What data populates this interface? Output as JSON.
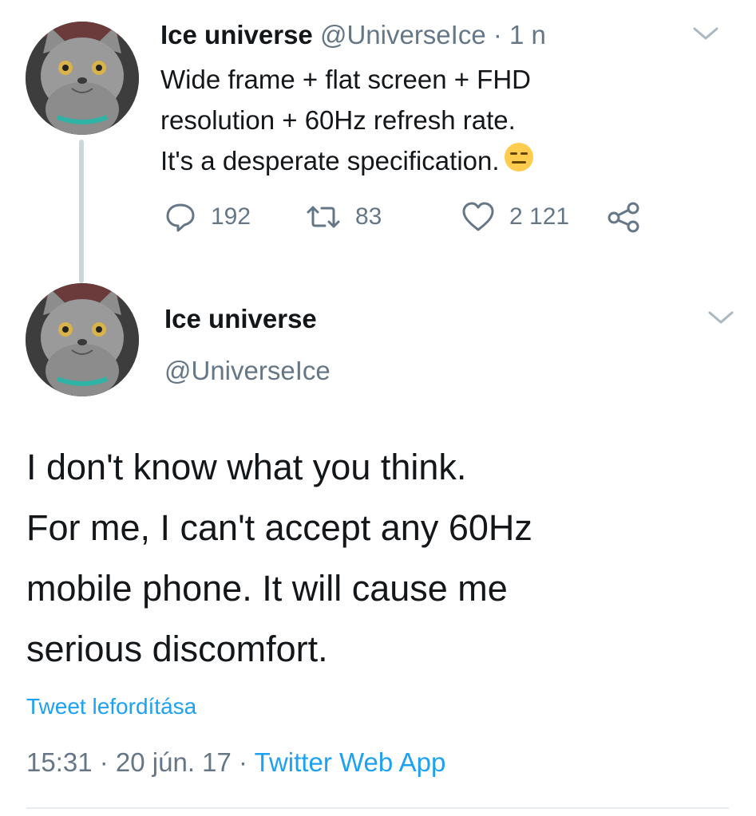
{
  "tweet1": {
    "name": "Ice universe",
    "handle": "@UniverseIce",
    "separator": " · ",
    "time": "1 n",
    "text_lines": [
      "Wide frame + flat screen + FHD",
      "resolution + 60Hz refresh rate.",
      "It's a desperate specification."
    ],
    "emoji": "expressionless-face",
    "replies": "192",
    "retweets": "83",
    "likes": "2 121"
  },
  "tweet2": {
    "name": "Ice universe",
    "handle": "@UniverseIce",
    "text_lines": [
      "I don't know what you think.",
      "For me, I can't accept any 60Hz",
      "mobile phone. It will cause me",
      "serious discomfort."
    ],
    "translate_label": "Tweet lefordítása",
    "time": "15:31",
    "date": "20 jún. 17",
    "separator": " · ",
    "source": "Twitter Web App"
  },
  "icons": {
    "reply": "reply-icon",
    "retweet": "retweet-icon",
    "like": "heart-icon",
    "share": "share-icon",
    "more": "chevron-down-icon"
  },
  "colors": {
    "accent": "#1da1f2",
    "secondary_text": "#657786",
    "primary_text": "#14171a",
    "thread_line": "#ccd6dd"
  }
}
